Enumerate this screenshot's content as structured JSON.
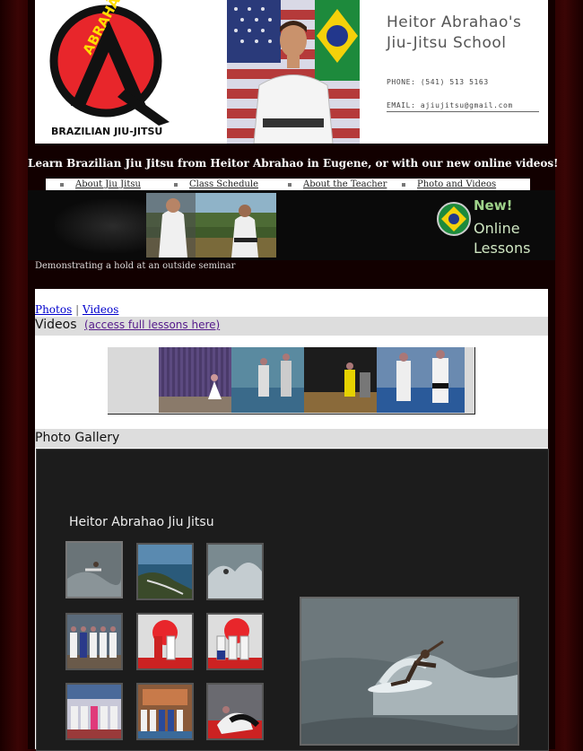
{
  "header": {
    "logo_arc_text": "ABRAHÃO",
    "logo_bottom_text": "BRAZILIAN JIU-JITSU",
    "school_title_line1": "Heitor Abrahao's",
    "school_title_line2": "Jiu-Jitsu School",
    "phone": "PHONE: (541) 513 5163",
    "email": "EMAIL: ajiujitsu@gmail.com"
  },
  "tagline": "Learn Brazilian Jiu Jitsu from Heitor Abrahao in Eugene, or with our new online videos!",
  "nav": {
    "items": [
      {
        "label": "About Jiu Jitsu"
      },
      {
        "label": "Class Schedule"
      },
      {
        "label": "About the Teacher"
      },
      {
        "label": "Photo and Videos"
      }
    ]
  },
  "banner": {
    "badge_new": "New!",
    "badge_line1": "Online",
    "badge_line2": "Lessons",
    "caption": "Demonstrating a hold at an outside seminar"
  },
  "content": {
    "photos_link": "Photos",
    "separator": "|",
    "videos_link": "Videos",
    "videos_title": "Videos",
    "videos_access_link": "(access full lessons here)",
    "gallery_section_title": "Photo Gallery",
    "gallery_name": "Heitor Abrahao Jiu Jitsu"
  },
  "colors": {
    "page_bg": "#2a0000",
    "logo_red": "#e8262b",
    "link_blue": "#0000cc",
    "link_visited": "#551a8b",
    "gallery_bg": "#1c1c1c"
  }
}
